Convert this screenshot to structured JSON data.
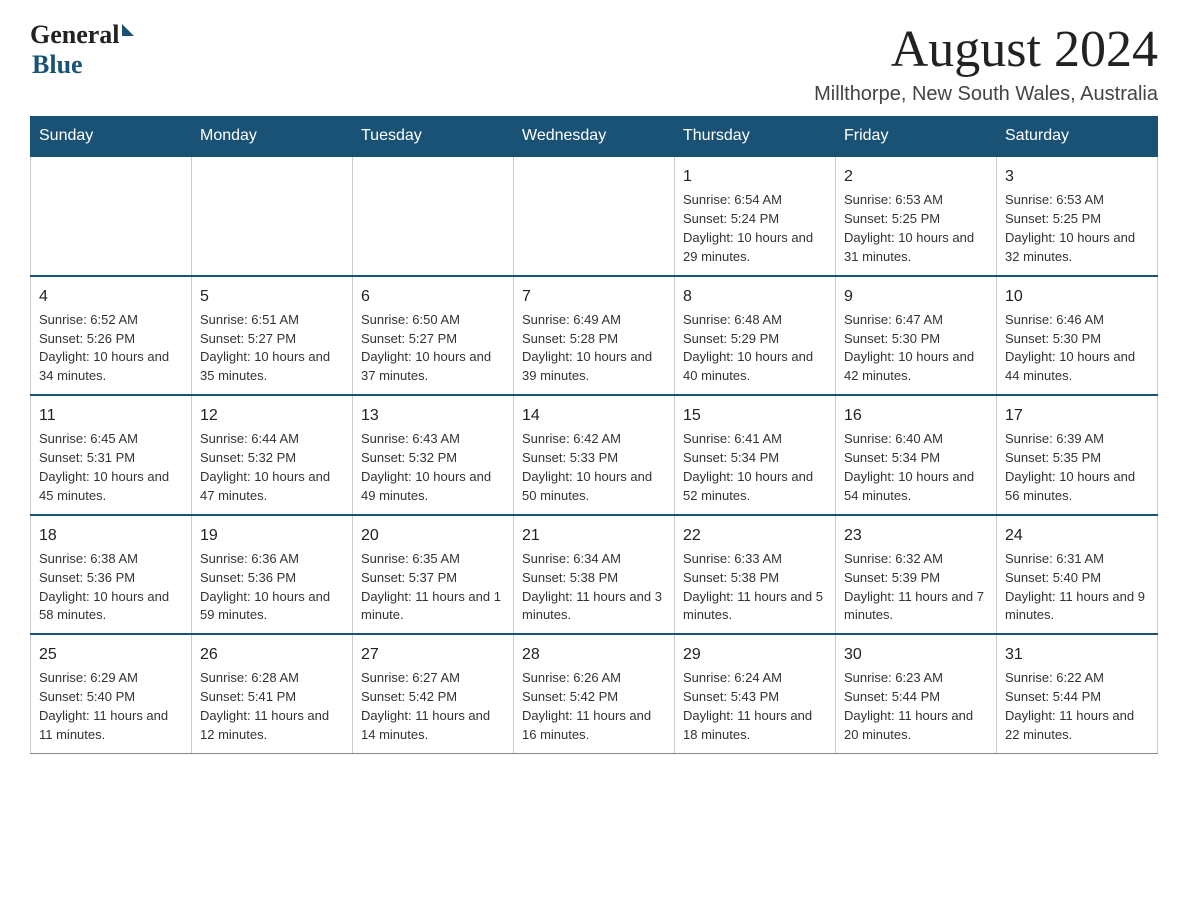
{
  "header": {
    "logo_general": "General",
    "logo_blue": "Blue",
    "title": "August 2024",
    "subtitle": "Millthorpe, New South Wales, Australia"
  },
  "days_of_week": [
    "Sunday",
    "Monday",
    "Tuesday",
    "Wednesday",
    "Thursday",
    "Friday",
    "Saturday"
  ],
  "weeks": [
    [
      {
        "day": "",
        "info": ""
      },
      {
        "day": "",
        "info": ""
      },
      {
        "day": "",
        "info": ""
      },
      {
        "day": "",
        "info": ""
      },
      {
        "day": "1",
        "info": "Sunrise: 6:54 AM\nSunset: 5:24 PM\nDaylight: 10 hours and 29 minutes."
      },
      {
        "day": "2",
        "info": "Sunrise: 6:53 AM\nSunset: 5:25 PM\nDaylight: 10 hours and 31 minutes."
      },
      {
        "day": "3",
        "info": "Sunrise: 6:53 AM\nSunset: 5:25 PM\nDaylight: 10 hours and 32 minutes."
      }
    ],
    [
      {
        "day": "4",
        "info": "Sunrise: 6:52 AM\nSunset: 5:26 PM\nDaylight: 10 hours and 34 minutes."
      },
      {
        "day": "5",
        "info": "Sunrise: 6:51 AM\nSunset: 5:27 PM\nDaylight: 10 hours and 35 minutes."
      },
      {
        "day": "6",
        "info": "Sunrise: 6:50 AM\nSunset: 5:27 PM\nDaylight: 10 hours and 37 minutes."
      },
      {
        "day": "7",
        "info": "Sunrise: 6:49 AM\nSunset: 5:28 PM\nDaylight: 10 hours and 39 minutes."
      },
      {
        "day": "8",
        "info": "Sunrise: 6:48 AM\nSunset: 5:29 PM\nDaylight: 10 hours and 40 minutes."
      },
      {
        "day": "9",
        "info": "Sunrise: 6:47 AM\nSunset: 5:30 PM\nDaylight: 10 hours and 42 minutes."
      },
      {
        "day": "10",
        "info": "Sunrise: 6:46 AM\nSunset: 5:30 PM\nDaylight: 10 hours and 44 minutes."
      }
    ],
    [
      {
        "day": "11",
        "info": "Sunrise: 6:45 AM\nSunset: 5:31 PM\nDaylight: 10 hours and 45 minutes."
      },
      {
        "day": "12",
        "info": "Sunrise: 6:44 AM\nSunset: 5:32 PM\nDaylight: 10 hours and 47 minutes."
      },
      {
        "day": "13",
        "info": "Sunrise: 6:43 AM\nSunset: 5:32 PM\nDaylight: 10 hours and 49 minutes."
      },
      {
        "day": "14",
        "info": "Sunrise: 6:42 AM\nSunset: 5:33 PM\nDaylight: 10 hours and 50 minutes."
      },
      {
        "day": "15",
        "info": "Sunrise: 6:41 AM\nSunset: 5:34 PM\nDaylight: 10 hours and 52 minutes."
      },
      {
        "day": "16",
        "info": "Sunrise: 6:40 AM\nSunset: 5:34 PM\nDaylight: 10 hours and 54 minutes."
      },
      {
        "day": "17",
        "info": "Sunrise: 6:39 AM\nSunset: 5:35 PM\nDaylight: 10 hours and 56 minutes."
      }
    ],
    [
      {
        "day": "18",
        "info": "Sunrise: 6:38 AM\nSunset: 5:36 PM\nDaylight: 10 hours and 58 minutes."
      },
      {
        "day": "19",
        "info": "Sunrise: 6:36 AM\nSunset: 5:36 PM\nDaylight: 10 hours and 59 minutes."
      },
      {
        "day": "20",
        "info": "Sunrise: 6:35 AM\nSunset: 5:37 PM\nDaylight: 11 hours and 1 minute."
      },
      {
        "day": "21",
        "info": "Sunrise: 6:34 AM\nSunset: 5:38 PM\nDaylight: 11 hours and 3 minutes."
      },
      {
        "day": "22",
        "info": "Sunrise: 6:33 AM\nSunset: 5:38 PM\nDaylight: 11 hours and 5 minutes."
      },
      {
        "day": "23",
        "info": "Sunrise: 6:32 AM\nSunset: 5:39 PM\nDaylight: 11 hours and 7 minutes."
      },
      {
        "day": "24",
        "info": "Sunrise: 6:31 AM\nSunset: 5:40 PM\nDaylight: 11 hours and 9 minutes."
      }
    ],
    [
      {
        "day": "25",
        "info": "Sunrise: 6:29 AM\nSunset: 5:40 PM\nDaylight: 11 hours and 11 minutes."
      },
      {
        "day": "26",
        "info": "Sunrise: 6:28 AM\nSunset: 5:41 PM\nDaylight: 11 hours and 12 minutes."
      },
      {
        "day": "27",
        "info": "Sunrise: 6:27 AM\nSunset: 5:42 PM\nDaylight: 11 hours and 14 minutes."
      },
      {
        "day": "28",
        "info": "Sunrise: 6:26 AM\nSunset: 5:42 PM\nDaylight: 11 hours and 16 minutes."
      },
      {
        "day": "29",
        "info": "Sunrise: 6:24 AM\nSunset: 5:43 PM\nDaylight: 11 hours and 18 minutes."
      },
      {
        "day": "30",
        "info": "Sunrise: 6:23 AM\nSunset: 5:44 PM\nDaylight: 11 hours and 20 minutes."
      },
      {
        "day": "31",
        "info": "Sunrise: 6:22 AM\nSunset: 5:44 PM\nDaylight: 11 hours and 22 minutes."
      }
    ]
  ]
}
